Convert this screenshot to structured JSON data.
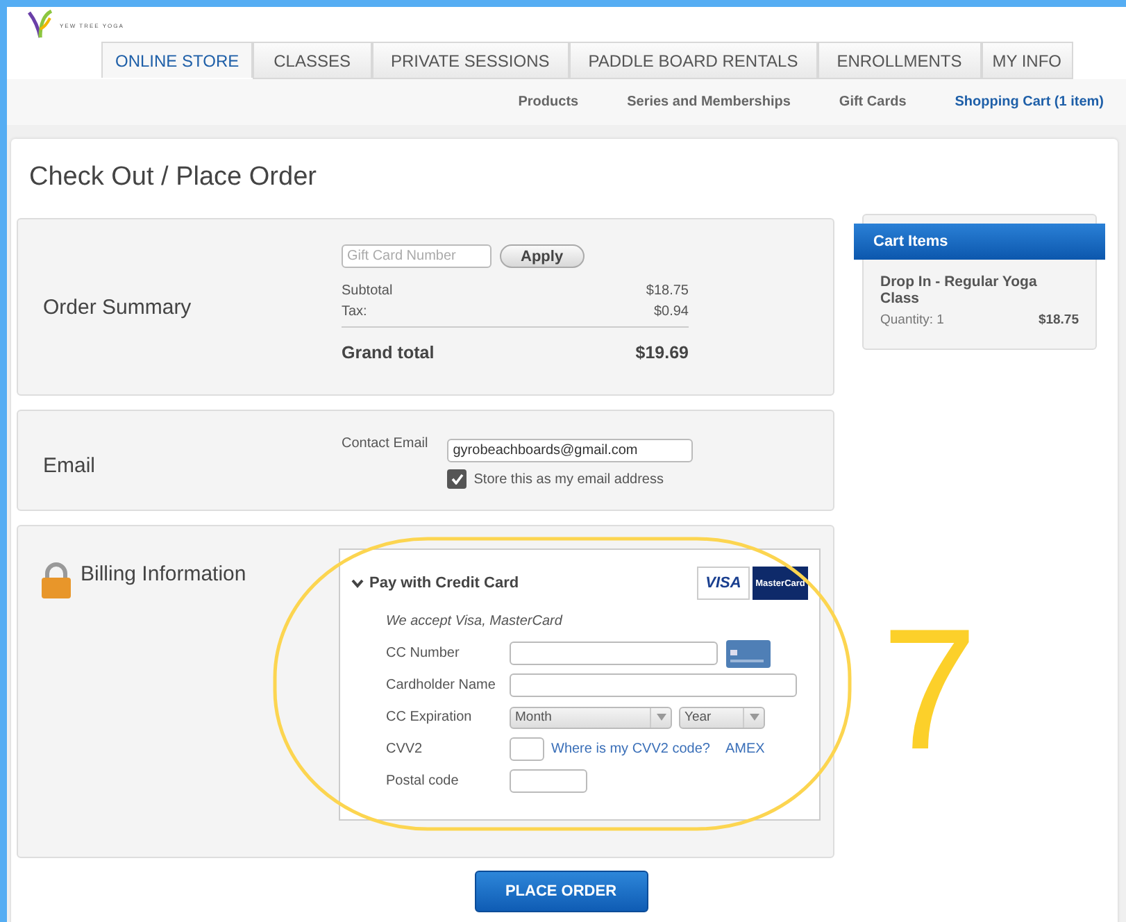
{
  "logo": {
    "text": "YEW TREE YOGA"
  },
  "tabs": [
    {
      "label": "ONLINE STORE",
      "selected": true
    },
    {
      "label": "CLASSES",
      "selected": false
    },
    {
      "label": "PRIVATE SESSIONS",
      "selected": false
    },
    {
      "label": "PADDLE BOARD RENTALS",
      "selected": false
    },
    {
      "label": "ENROLLMENTS",
      "selected": false
    },
    {
      "label": "MY INFO",
      "selected": false
    }
  ],
  "subnav": [
    {
      "label": "Products",
      "selected": false
    },
    {
      "label": "Series and Memberships",
      "selected": false
    },
    {
      "label": "Gift Cards",
      "selected": false
    },
    {
      "label": "Shopping Cart (1 item)",
      "selected": true
    }
  ],
  "page_title": "Check Out / Place Order",
  "order_summary": {
    "title": "Order Summary",
    "gift_card": {
      "placeholder": "Gift Card Number"
    },
    "apply_button": "Apply",
    "lines": [
      {
        "label": "Subtotal",
        "value": "$18.75"
      },
      {
        "label": "Tax:",
        "value": "$0.94"
      }
    ],
    "total_label": "Grand total",
    "total_value": "$19.69"
  },
  "email": {
    "title": "Email",
    "label": "Contact Email",
    "value": "gyrobeachboards@gmail.com",
    "store_label": "Store this as my email address",
    "store_checked": true
  },
  "billing": {
    "title": "Billing Information",
    "method": "Pay with Credit Card",
    "expanded": true,
    "card_logos": [
      "VISA",
      "MasterCard"
    ],
    "accept_note": "We accept Visa, MasterCard",
    "fields": [
      {
        "kind": "card",
        "label": "CC Number"
      },
      {
        "kind": "text",
        "label": "Cardholder Name"
      },
      {
        "kind": "selects",
        "label": "CC Expiration",
        "selects": [
          "Month",
          "Year"
        ]
      },
      {
        "kind": "cvv",
        "label": "CVV2",
        "links": [
          "Where is my CVV2 code?",
          "AMEX"
        ]
      },
      {
        "kind": "short",
        "label": "Postal code"
      }
    ]
  },
  "place_order": "PLACE ORDER",
  "cart": {
    "title": "Cart Items",
    "items": [
      {
        "name": "Drop In - Regular Yoga Class",
        "quantity": "Quantity: 1",
        "price": "$18.75"
      }
    ]
  },
  "annotation": {
    "number": "7"
  }
}
